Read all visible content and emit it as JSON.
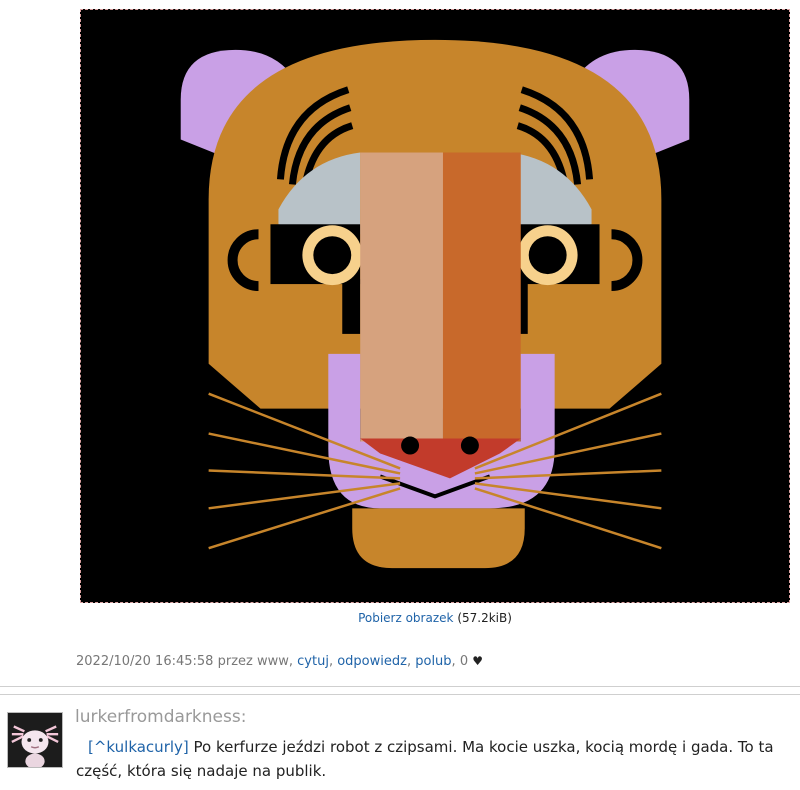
{
  "image": {
    "alt": "",
    "background_color": "#000000",
    "colors": {
      "fur": "#c7852b",
      "ear": "#c9a0e6",
      "eye_white": "#b8c2c8",
      "nose_light": "#d6a27e",
      "nose_dark": "#c8692b",
      "muzzle": "#c9a0e6",
      "nose_tip": "#c23b2b",
      "iris": "#f7d18c"
    }
  },
  "download": {
    "link_label": "Pobierz obrazek",
    "size": "(57.2kiB)"
  },
  "post_meta": {
    "timestamp": "2022/10/20 16:45:58",
    "by_text": "przez www,",
    "actions": {
      "quote": "cytuj",
      "reply": "odpowiedz",
      "like": "polub"
    },
    "like_count": "0",
    "heart_icon": "♥"
  },
  "comment": {
    "username": "lurkerfromdarkness:",
    "reply_to": "[^kulkacurly]",
    "text": "Po kerfurze jeździ robot z czipsami. Ma kocie uszka, kocią mordę i gada. To ta część, która się nadaje na publik."
  }
}
